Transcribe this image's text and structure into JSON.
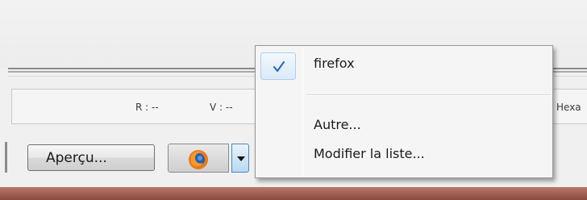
{
  "color_info": {
    "r_label": "R : --",
    "v_label": "V : --",
    "hex_label": "Hexa"
  },
  "toolbar": {
    "preview_button_label": "Aperçu...",
    "browser_icon": "firefox-icon",
    "dropdown_icon": "chevron-down-icon"
  },
  "context_menu": {
    "items": [
      {
        "label": "firefox",
        "checked": true,
        "icon": "check-icon"
      },
      {
        "label": "Autre...",
        "checked": false
      },
      {
        "label": "Modifier la liste...",
        "checked": false
      }
    ]
  },
  "colors": {
    "check_accent": "#2d6ab4",
    "dropdown_accent": "#4f86b8",
    "bottom_bar": "#8a4a3e"
  }
}
